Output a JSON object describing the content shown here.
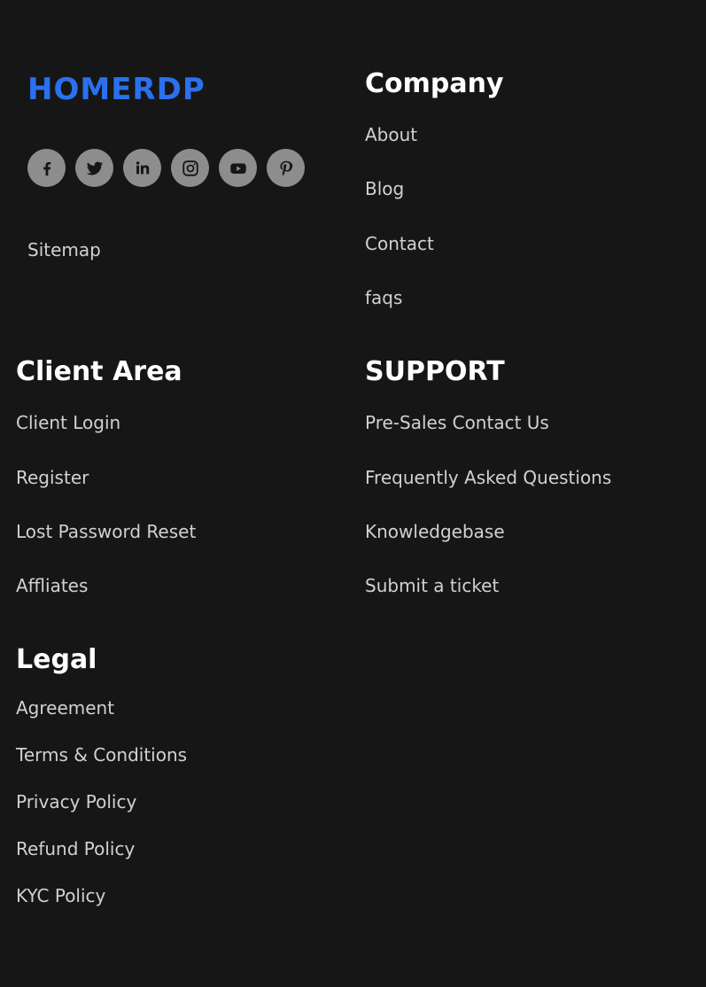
{
  "brand": {
    "logo_text": "HOMERDP",
    "logo_color": "#2a70ef"
  },
  "social": [
    {
      "name": "facebook",
      "icon": "facebook-icon"
    },
    {
      "name": "twitter",
      "icon": "twitter-icon"
    },
    {
      "name": "linkedin",
      "icon": "linkedin-icon"
    },
    {
      "name": "instagram",
      "icon": "instagram-icon"
    },
    {
      "name": "youtube",
      "icon": "youtube-icon"
    },
    {
      "name": "pinterest",
      "icon": "pinterest-icon"
    }
  ],
  "sitemap_label": "Sitemap",
  "company": {
    "heading": "Company",
    "links": [
      "About",
      "Blog",
      "Contact",
      "faqs"
    ]
  },
  "client_area": {
    "heading": "Client Area",
    "links": [
      "Client Login",
      "Register",
      "Lost Password Reset",
      "Affliates"
    ]
  },
  "support": {
    "heading": "SUPPORT",
    "links": [
      "Pre-Sales Contact Us",
      "Frequently Asked Questions",
      "Knowledgebase",
      "Submit a ticket"
    ]
  },
  "legal": {
    "heading": "Legal",
    "links": [
      "Agreement",
      "Terms & Conditions",
      "Privacy Policy",
      "Refund Policy",
      "KYC Policy"
    ]
  },
  "colors": {
    "background": "#161616",
    "icon_circle": "#8d8d8d",
    "heading": "#ffffff",
    "link": "#d1d1d1"
  }
}
